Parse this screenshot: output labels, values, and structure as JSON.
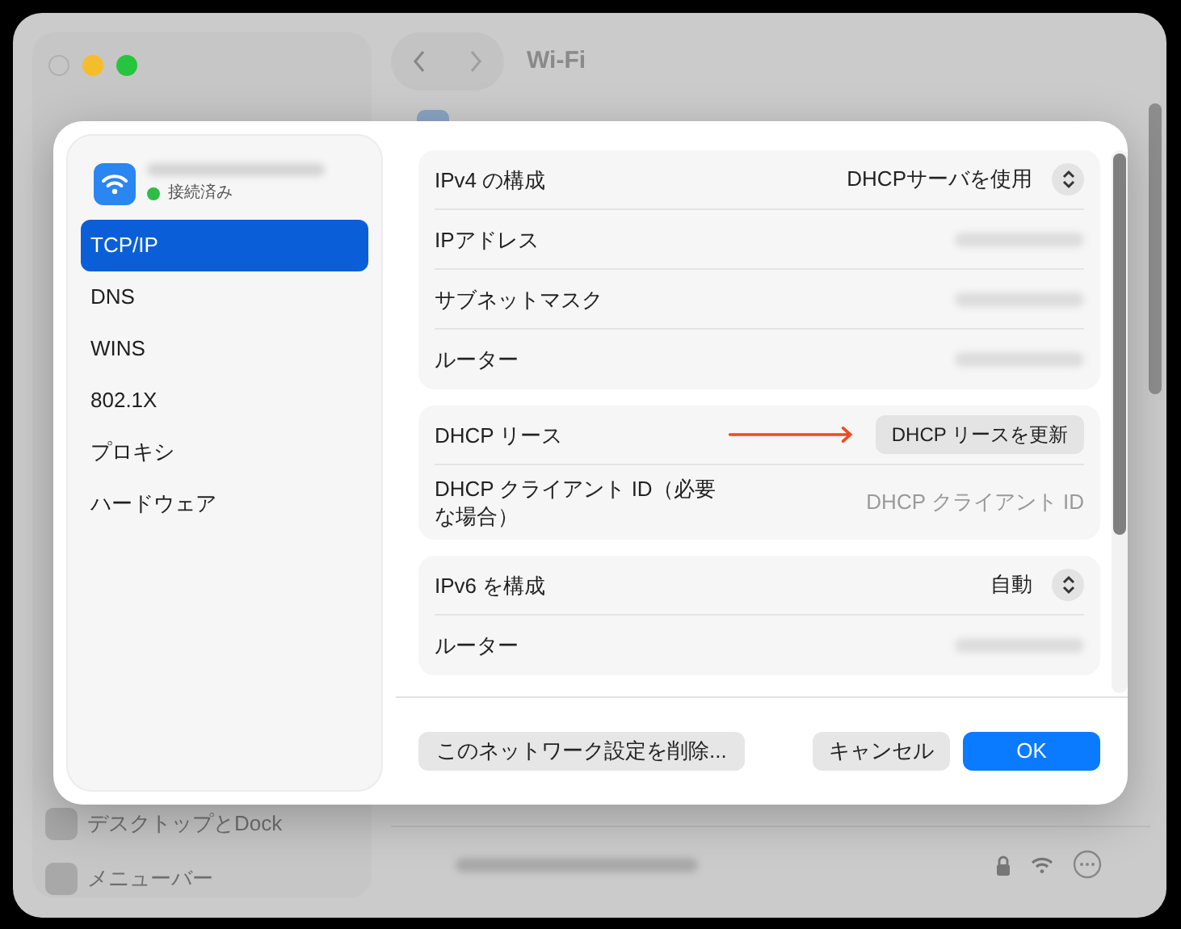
{
  "background": {
    "title": "Wi-Fi",
    "sidebar_items": [
      {
        "label": "デスクトップとDock"
      },
      {
        "label": "メニューバー"
      }
    ]
  },
  "sheet": {
    "network": {
      "status": "接続済み",
      "connected": true
    },
    "sidebar": [
      {
        "label": "TCP/IP",
        "selected": true
      },
      {
        "label": "DNS",
        "selected": false
      },
      {
        "label": "WINS",
        "selected": false
      },
      {
        "label": "802.1X",
        "selected": false
      },
      {
        "label": "プロキシ",
        "selected": false
      },
      {
        "label": "ハードウェア",
        "selected": false
      }
    ],
    "groups": [
      {
        "rows": [
          {
            "kind": "popup",
            "label": "IPv4 の構成",
            "value": "DHCPサーバを使用"
          },
          {
            "kind": "redacted",
            "label": "IPアドレス"
          },
          {
            "kind": "redacted",
            "label": "サブネットマスク"
          },
          {
            "kind": "redacted",
            "label": "ルーター"
          }
        ]
      },
      {
        "rows": [
          {
            "kind": "button",
            "label": "DHCP リース",
            "button": "DHCP リースを更新"
          },
          {
            "kind": "field",
            "label": "DHCP クライアント ID（必要な場合）",
            "placeholder": "DHCP クライアント ID"
          }
        ]
      },
      {
        "rows": [
          {
            "kind": "popup",
            "label": "IPv6 を構成",
            "value": "自動"
          },
          {
            "kind": "redacted",
            "label": "ルーター"
          }
        ]
      }
    ],
    "footer": {
      "delete_button": "このネットワーク設定を削除...",
      "cancel_button": "キャンセル",
      "ok_button": "OK"
    }
  }
}
